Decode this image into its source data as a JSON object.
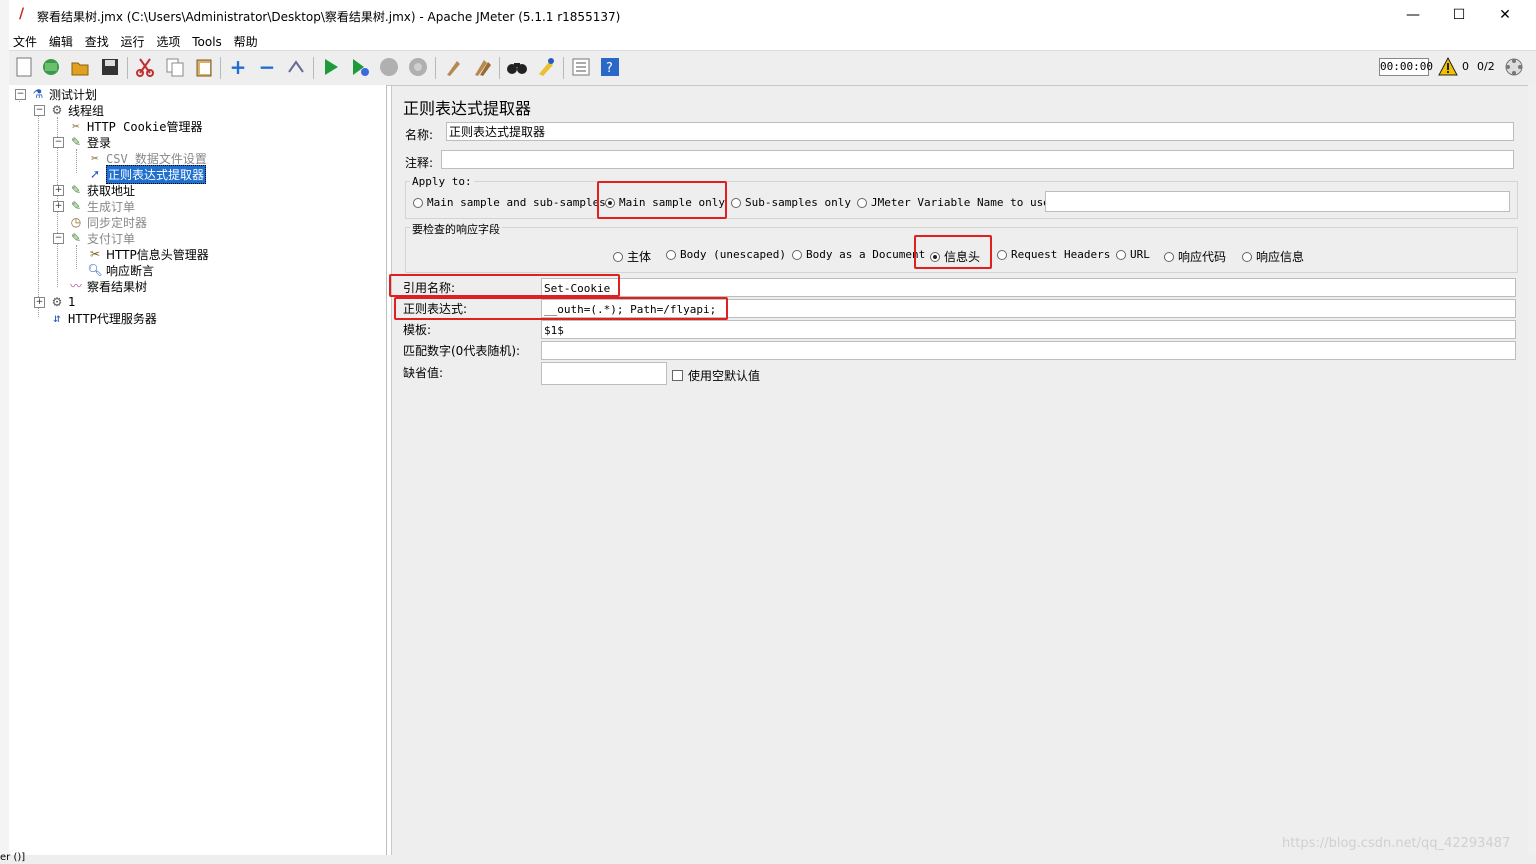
{
  "window": {
    "title": "察看结果树.jmx (C:\\Users\\Administrator\\Desktop\\察看结果树.jmx) - Apache JMeter (5.1.1 r1855137)",
    "minimize": "—",
    "maximize": "☐",
    "close": "✕"
  },
  "menu": [
    "文件",
    "编辑",
    "查找",
    "运行",
    "选项",
    "Tools",
    "帮助"
  ],
  "toolbar": {
    "timer": "00:00:00",
    "warn_count": "0",
    "threads": "0/2"
  },
  "tree": {
    "items": [
      {
        "label": "测试计划",
        "icon": "beaker-icon"
      },
      {
        "label": "线程组",
        "icon": "gear-icon"
      },
      {
        "label": "HTTP Cookie管理器",
        "icon": "wrench-icon"
      },
      {
        "label": "登录",
        "icon": "dropper-icon"
      },
      {
        "label": "CSV 数据文件设置",
        "icon": "wrench-icon"
      },
      {
        "label": "正则表达式提取器",
        "icon": "arrow-icon"
      },
      {
        "label": "获取地址",
        "icon": "dropper-icon"
      },
      {
        "label": "生成订单",
        "icon": "dropper-icon"
      },
      {
        "label": "同步定时器",
        "icon": "clock-icon"
      },
      {
        "label": "支付订单",
        "icon": "dropper-icon"
      },
      {
        "label": "HTTP信息头管理器",
        "icon": "wrench-icon"
      },
      {
        "label": "响应断言",
        "icon": "magnifier-icon"
      },
      {
        "label": "察看结果树",
        "icon": "chart-icon"
      },
      {
        "label": "1",
        "icon": "gear-icon"
      },
      {
        "label": "HTTP代理服务器",
        "icon": "proxy-icon"
      }
    ]
  },
  "panel": {
    "title": "正则表达式提取器",
    "name_label": "名称:",
    "name_value": "正则表达式提取器",
    "comment_label": "注释:",
    "comment_value": "",
    "apply_to": {
      "caption": "Apply to:",
      "options": [
        "Main sample and sub-samples",
        "Main sample only",
        "Sub-samples only",
        "JMeter Variable Name to use"
      ],
      "selected": "Main sample only",
      "variable_value": ""
    },
    "field_to_check": {
      "caption": "要检查的响应字段",
      "options": [
        "主体",
        "Body (unescaped)",
        "Body as a Document",
        "信息头",
        "Request Headers",
        "URL",
        "响应代码",
        "响应信息"
      ],
      "selected": "信息头"
    },
    "ref_name_label": "引用名称:",
    "ref_name_value": "Set-Cookie",
    "regex_label": "正则表达式:",
    "regex_value": "__outh=(.*); Path=/flyapi;",
    "template_label": "模板:",
    "template_value": "$1$",
    "match_no_label": "匹配数字(0代表随机):",
    "match_no_value": "",
    "default_label": "缺省值:",
    "default_value": "",
    "use_empty_label": "使用空默认值"
  },
  "highlight_color": "#e02020",
  "watermark": "https://blog.csdn.net/qq_42293487",
  "bottom_text": "er ()]"
}
